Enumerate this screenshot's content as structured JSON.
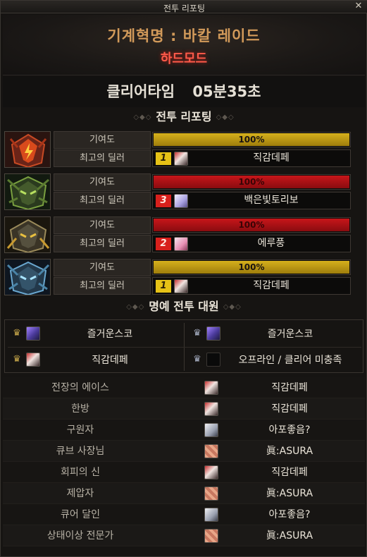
{
  "window": {
    "title": "전투 리포팅",
    "close_icon": "close-icon"
  },
  "raid": {
    "name": "기계혁명 : 바칼 레이드",
    "mode": "하드모드"
  },
  "clear_time": {
    "label": "클리어타임",
    "value": "05분35초"
  },
  "report_title": "전투 리포팅",
  "labels": {
    "contribution": "기여도",
    "best_dealer": "최고의 딜러"
  },
  "bosses": [
    {
      "icon": "fire-dragon-helm-icon",
      "contribution": "100%",
      "contribution_fraction": 1.0,
      "bar_color": "gold",
      "rank": "1",
      "rank_color": "gold",
      "avatar": "red-avatar",
      "dealer": "직감데페"
    },
    {
      "icon": "green-dragon-helm-icon",
      "contribution": "100%",
      "contribution_fraction": 1.0,
      "bar_color": "red",
      "rank": "3",
      "rank_color": "red",
      "avatar": "white-avatar",
      "dealer": "백은빛토리보"
    },
    {
      "icon": "gold-dragon-helm-icon",
      "contribution": "100%",
      "contribution_fraction": 1.0,
      "bar_color": "red",
      "rank": "2",
      "rank_color": "red",
      "avatar": "pink-avatar",
      "dealer": "에루풍"
    },
    {
      "icon": "ice-dragon-helm-icon",
      "contribution": "100%",
      "contribution_fraction": 1.0,
      "bar_color": "gold",
      "rank": "1",
      "rank_color": "gold",
      "avatar": "red-avatar",
      "dealer": "직감데페"
    }
  ],
  "honor_title": "명예 전투 대원",
  "honor": [
    {
      "crown": "gold-crown-icon",
      "avatar": "purple-avatar",
      "name": "즐거운스코"
    },
    {
      "crown": "silver-crown-icon",
      "avatar": "purple-avatar",
      "name": "즐거운스코"
    },
    {
      "crown": "gold-crown-icon",
      "avatar": "red-avatar",
      "name": "직감데페"
    },
    {
      "crown": "silver-crown-icon",
      "avatar": "empty-avatar",
      "name": "오프라인 / 클리어 미충족"
    }
  ],
  "awards": [
    {
      "title": "전장의 에이스",
      "avatar": "red-avatar",
      "name": "직감데페"
    },
    {
      "title": "한방",
      "avatar": "red-avatar",
      "name": "직감데페"
    },
    {
      "title": "구원자",
      "avatar": "gray-avatar",
      "name": "아포좋음?"
    },
    {
      "title": "큐브 사장님",
      "avatar": "skin-avatar",
      "name": "眞:ASURA"
    },
    {
      "title": "회피의 신",
      "avatar": "red-avatar",
      "name": "직감데페"
    },
    {
      "title": "제압자",
      "avatar": "skin-avatar",
      "name": "眞:ASURA"
    },
    {
      "title": "큐어 달인",
      "avatar": "gray-avatar",
      "name": "아포좋음?"
    },
    {
      "title": "상태이상 전문가",
      "avatar": "skin-avatar",
      "name": "眞:ASURA"
    }
  ],
  "colors": {
    "gold_bar": "#d6b01c",
    "red_bar": "#c8161a",
    "mode_text": "#ff5a4a",
    "raid_title": "#d29a5a"
  }
}
